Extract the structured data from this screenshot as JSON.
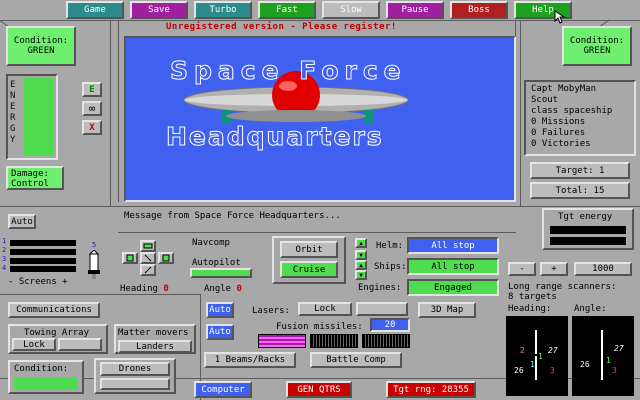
{
  "menu": {
    "items": [
      {
        "label": "Game",
        "color": "#2c8c8c"
      },
      {
        "label": "Save",
        "color": "#a020a0"
      },
      {
        "label": "Turbo",
        "color": "#2c8c8c"
      },
      {
        "label": "Fast",
        "color": "#20a020"
      },
      {
        "label": "Slow",
        "color": "#bcbcbc"
      },
      {
        "label": "Pause",
        "color": "#a020a0"
      },
      {
        "label": "Boss",
        "color": "#b02020"
      },
      {
        "label": "Help",
        "color": "#20a020"
      }
    ]
  },
  "banner": "Unregistered version - Please register!",
  "left_condition": {
    "label": "Condition:",
    "value": "GREEN"
  },
  "right_condition": {
    "label": "Condition:",
    "value": "GREEN"
  },
  "energy": {
    "label": "ENERGY",
    "btn_e": "E",
    "btn_infinity": "∞",
    "btn_x": "X"
  },
  "damage": {
    "label": "Damage:",
    "value": "Control"
  },
  "viewscreen": {
    "title_line1": "Space Force",
    "title_line2": "Headquarters",
    "bg_color": "#4060f0"
  },
  "info": {
    "lines": [
      "Capt MobyMan",
      "Scout",
      "class spaceship",
      "0 Missions",
      "0 Failures",
      "0 Victories"
    ]
  },
  "target": {
    "target_label": "Target: 1",
    "total_label": "Total: 15"
  },
  "tgt_energy": {
    "label": "Tgt energy"
  },
  "screens": {
    "auto": "Auto",
    "label": "- Screens +",
    "ticks": [
      "1",
      "2",
      "3",
      "4",
      "5"
    ]
  },
  "message": "Message from Space Force Headquarters...",
  "nav": {
    "navcomp": "Navcomp",
    "autopilot": "Autopilot",
    "heading_label": "Heading",
    "heading_value": "0",
    "angle_label": "Angle",
    "angle_value": "0"
  },
  "orbit": {
    "orbit": "Orbit",
    "cruise": "Cruise"
  },
  "status": {
    "helm_label": "Helm:",
    "helm_value": "All stop",
    "ships_label": "Ships:",
    "ships_value": "All stop",
    "engines_label": "Engines:",
    "engines_value": "Engaged"
  },
  "scanner": {
    "minus": "-",
    "plus": "+",
    "range": "1000",
    "title": "Long range scanners:",
    "targets": "8 targets",
    "heading_label": "Heading:",
    "angle_label": "Angle:",
    "heading_numbers": [
      "2",
      "1",
      "27",
      "26",
      "1",
      "3"
    ],
    "angle_numbers": [
      "27",
      "26",
      "1",
      "3"
    ]
  },
  "communications": "Communications",
  "towing": {
    "title": "Towing Array",
    "lock": "Lock"
  },
  "matter": {
    "title": "Matter movers",
    "landers": "Landers"
  },
  "weapons": {
    "auto1": "Auto",
    "auto2": "Auto",
    "lasers_label": "Lasers:",
    "lasers_lock": "Lock",
    "fusion_label": "Fusion missiles:",
    "fusion_value": "20",
    "beams": "1 Beams/Racks",
    "battle": "Battle Comp"
  },
  "map3d": "3D Map",
  "bottom_condition": "Condition:",
  "drones": "Drones",
  "computer": "Computer",
  "gen_qtrs": "GEN QTRS",
  "tgt_rng": "Tgt rng: 28355"
}
